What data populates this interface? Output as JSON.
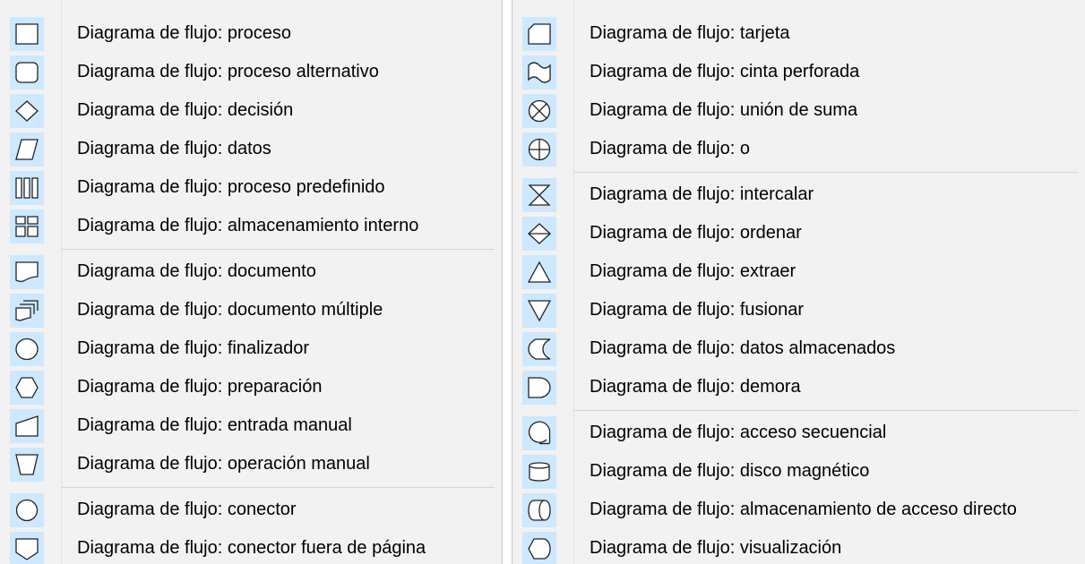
{
  "left": {
    "items": [
      {
        "label": "Diagrama de flujo: proceso",
        "icon": "process-icon"
      },
      {
        "label": "Diagrama de flujo: proceso alternativo",
        "icon": "alternate-process-icon"
      },
      {
        "label": "Diagrama de flujo: decisión",
        "icon": "decision-icon"
      },
      {
        "label": "Diagrama de flujo: datos",
        "icon": "data-icon"
      },
      {
        "label": "Diagrama de flujo: proceso predefinido",
        "icon": "predefined-process-icon"
      },
      {
        "label": "Diagrama de flujo: almacenamiento interno",
        "icon": "internal-storage-icon"
      },
      {
        "label": "Diagrama de flujo: documento",
        "icon": "document-icon"
      },
      {
        "label": "Diagrama de flujo: documento múltiple",
        "icon": "multidocument-icon"
      },
      {
        "label": "Diagrama de flujo: finalizador",
        "icon": "terminator-icon"
      },
      {
        "label": "Diagrama de flujo: preparación",
        "icon": "preparation-icon"
      },
      {
        "label": "Diagrama de flujo: entrada manual",
        "icon": "manual-input-icon"
      },
      {
        "label": "Diagrama de flujo: operación manual",
        "icon": "manual-operation-icon"
      },
      {
        "label": "Diagrama de flujo: conector",
        "icon": "connector-icon"
      },
      {
        "label": "Diagrama de flujo: conector fuera de página",
        "icon": "offpage-connector-icon"
      }
    ]
  },
  "right": {
    "items": [
      {
        "label": "Diagrama de flujo: tarjeta",
        "icon": "card-icon"
      },
      {
        "label": "Diagrama de flujo: cinta perforada",
        "icon": "punched-tape-icon"
      },
      {
        "label": "Diagrama de flujo: unión de suma",
        "icon": "summing-junction-icon"
      },
      {
        "label": "Diagrama de flujo: o",
        "icon": "or-icon"
      },
      {
        "label": "Diagrama de flujo: intercalar",
        "icon": "collate-icon"
      },
      {
        "label": "Diagrama de flujo: ordenar",
        "icon": "sort-icon"
      },
      {
        "label": "Diagrama de flujo: extraer",
        "icon": "extract-icon"
      },
      {
        "label": "Diagrama de flujo: fusionar",
        "icon": "merge-icon"
      },
      {
        "label": "Diagrama de flujo: datos almacenados",
        "icon": "stored-data-icon"
      },
      {
        "label": "Diagrama de flujo: demora",
        "icon": "delay-icon"
      },
      {
        "label": "Diagrama de flujo: acceso secuencial",
        "icon": "sequential-access-icon"
      },
      {
        "label": "Diagrama de flujo: disco magnético",
        "icon": "magnetic-disk-icon"
      },
      {
        "label": "Diagrama de flujo: almacenamiento de acceso directo",
        "icon": "direct-access-storage-icon"
      },
      {
        "label": "Diagrama de flujo: visualización",
        "icon": "display-icon"
      }
    ]
  },
  "colors": {
    "icon_bg": "#cde8ff",
    "icon_stroke": "#222222",
    "menu_bg": "#f2f2f2"
  }
}
